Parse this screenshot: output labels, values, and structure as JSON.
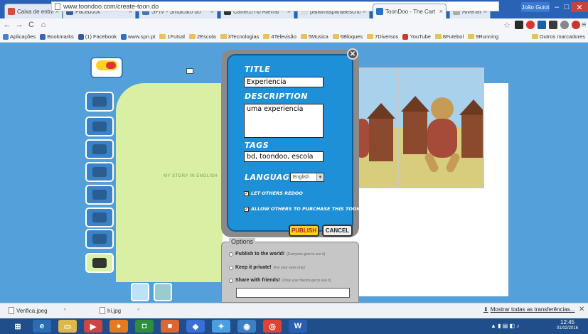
{
  "browser": {
    "tabs": [
      {
        "label": "Caixa de entrada (",
        "icon_color": "#d54b3d"
      },
      {
        "label": "Facebook",
        "icon_color": "#3b5998"
      },
      {
        "label": "SPIV - Sindicato do",
        "icon_color": "#4477aa"
      },
      {
        "label": "Caneco no Aterrar",
        "icon_color": "#333333"
      },
      {
        "label": "palavrasparaaescrita",
        "icon_color": "#dddddd"
      },
      {
        "label": "ToonDoo - The Cart",
        "icon_color": "#2a6fc9"
      },
      {
        "label": "Alvenar",
        "icon_color": "#aaaaaa"
      }
    ],
    "user": "João Guiot",
    "url": "www.toondoo.com/create-toon.do",
    "bookmarks": [
      {
        "label": "Aplicações",
        "type": "apps"
      },
      {
        "label": "Bookmarks",
        "type": "star"
      },
      {
        "label": "(1) Facebook",
        "type": "fb"
      },
      {
        "label": "www.spn.pt",
        "type": "site"
      },
      {
        "label": "1Futsal",
        "type": "folder"
      },
      {
        "label": "2Escola",
        "type": "folder"
      },
      {
        "label": "3Tecnologias",
        "type": "folder"
      },
      {
        "label": "4Televisão",
        "type": "folder"
      },
      {
        "label": "5Musica",
        "type": "folder"
      },
      {
        "label": "6Bloques",
        "type": "folder"
      },
      {
        "label": "7Diversos",
        "type": "folder"
      },
      {
        "label": "YouTube",
        "type": "yt"
      },
      {
        "label": "8Futebol",
        "type": "folder"
      },
      {
        "label": "9Running",
        "type": "folder"
      },
      {
        "label": "Outros marcadores",
        "type": "folder"
      }
    ]
  },
  "editor": {
    "canvas_text": "MY STORY IN ENGLISH"
  },
  "dialog": {
    "title_label": "TITLE",
    "title_value": "Experiencia",
    "description_label": "DESCRIPTION",
    "description_value": "uma experiencia",
    "tags_label": "TAGS",
    "tags_value": "bd, toondoo, escola",
    "language_label": "LANGUAGE",
    "language_value": "English",
    "let_others_redoo": "LET OTHERS REDOO",
    "allow_purchase": "ALLOW OTHERS TO PURCHASE THIS TOON",
    "publish_label": "PUBLISH",
    "cancel_label": "CANCEL"
  },
  "options": {
    "title": "Options",
    "items": [
      {
        "label": "Publish to the world!",
        "hint": "(Everyone gets to see it)"
      },
      {
        "label": "Keep it private!",
        "hint": "(For your eyes only)"
      },
      {
        "label": "Share with friends!",
        "hint": "(Only your friends get to see it)"
      }
    ]
  },
  "downloads": {
    "items": [
      "Verifica.jpeg",
      "hi.jpg"
    ],
    "show_all": "Mostrar todas as transferências..."
  },
  "taskbar": {
    "time": "12:45",
    "date": "01/02/2016"
  }
}
